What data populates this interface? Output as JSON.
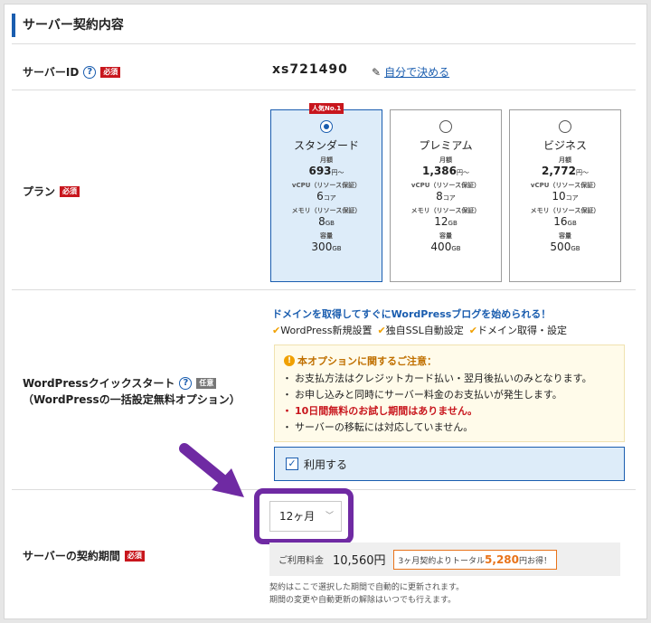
{
  "section": {
    "title": "サーバー契約内容"
  },
  "server_id": {
    "label": "サーバーID",
    "required": "必須",
    "value": "xs721490",
    "decide_link": "自分で決める"
  },
  "plan": {
    "label": "プラン",
    "required": "必須",
    "options": [
      {
        "badge": "人気No.1",
        "name": "スタンダード",
        "monthly_label": "月額",
        "price": "693",
        "price_unit": "円〜",
        "vcpu_label": "vCPU（リソース保証）",
        "vcpu": "6",
        "vcpu_unit": "コア",
        "mem_label": "メモリ（リソース保証）",
        "mem": "8",
        "mem_unit": "GB",
        "cap_label": "容量",
        "cap": "300",
        "cap_unit": "GB",
        "selected": true
      },
      {
        "badge": "",
        "name": "プレミアム",
        "monthly_label": "月額",
        "price": "1,386",
        "price_unit": "円〜",
        "vcpu_label": "vCPU（リソース保証）",
        "vcpu": "8",
        "vcpu_unit": "コア",
        "mem_label": "メモリ（リソース保証）",
        "mem": "12",
        "mem_unit": "GB",
        "cap_label": "容量",
        "cap": "400",
        "cap_unit": "GB",
        "selected": false
      },
      {
        "badge": "",
        "name": "ビジネス",
        "monthly_label": "月額",
        "price": "2,772",
        "price_unit": "円〜",
        "vcpu_label": "vCPU（リソース保証）",
        "vcpu": "10",
        "vcpu_unit": "コア",
        "mem_label": "メモリ（リソース保証）",
        "mem": "16",
        "mem_unit": "GB",
        "cap_label": "容量",
        "cap": "500",
        "cap_unit": "GB",
        "selected": false
      }
    ]
  },
  "wp": {
    "label": "WordPressクイックスタート",
    "optional": "任意",
    "sub_label": "（WordPressの一括設定無料オプション）",
    "lead": "ドメインを取得してすぐにWordPressブログを始められる！",
    "features": [
      "WordPress新規設置",
      "独自SSL自動設定",
      "ドメイン取得・設定"
    ],
    "notice_title": "本オプションに関するご注意：",
    "notices": [
      "お支払方法はクレジットカード払い・翌月後払いのみとなります。",
      "お申し込みと同時にサーバー料金のお支払いが発生します。",
      "10日間無料のお試し期間はありません。",
      "サーバーの移転には対応していません。"
    ],
    "use_label": "利用する",
    "use_checked": true
  },
  "term": {
    "label": "サーバーの契約期間",
    "required": "必須",
    "selected": "12ヶ月",
    "fee_label": "ご利用料金",
    "fee_amount": "10,560円",
    "savings_prefix": "3ヶ月契約よりトータル",
    "savings_amount": "5,280",
    "savings_suffix": "円お得！",
    "note_1": "契約はここで選択した期間で自動的に更新されます。",
    "note_2": "期間の変更や自動更新の解除はいつでも行えます。"
  },
  "colors": {
    "accent": "#1a5daf",
    "required": "#c8161d",
    "highlight": "#6f2aa3",
    "savings": "#e8731a"
  }
}
